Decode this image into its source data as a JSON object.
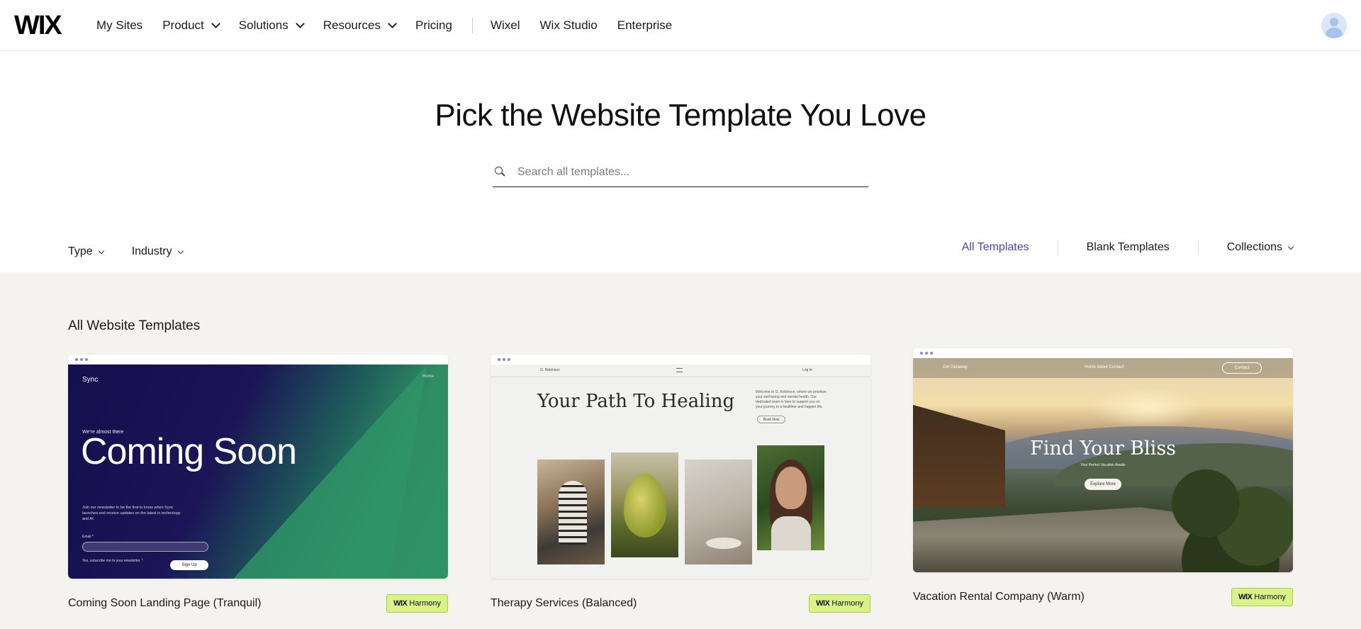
{
  "header": {
    "logo": "WIX",
    "nav": [
      {
        "label": "My Sites",
        "dropdown": false
      },
      {
        "label": "Product",
        "dropdown": true
      },
      {
        "label": "Solutions",
        "dropdown": true
      },
      {
        "label": "Resources",
        "dropdown": true
      },
      {
        "label": "Pricing",
        "dropdown": false
      },
      {
        "label": "Wixel",
        "dropdown": false
      },
      {
        "label": "Wix Studio",
        "dropdown": false
      },
      {
        "label": "Enterprise",
        "dropdown": false
      }
    ],
    "avatar_icon": "user-avatar-icon"
  },
  "hero": {
    "title": "Pick the Website Template You Love",
    "search_placeholder": "Search all templates...",
    "search_icon": "search-icon"
  },
  "filters": {
    "type_label": "Type",
    "industry_label": "Industry",
    "tabs": [
      {
        "label": "All Templates",
        "active": true
      },
      {
        "label": "Blank Templates",
        "active": false
      },
      {
        "label": "Collections",
        "active": false,
        "dropdown": true
      }
    ]
  },
  "gallery": {
    "section_title": "All Website Templates",
    "badge_brand": "WIX",
    "badge_text": "Harmony",
    "cards": [
      {
        "name": "Coming Soon Landing Page (Tranquil)",
        "preview": {
          "brand": "Sync",
          "nav": "Home",
          "pre": "We're almost there",
          "headline": "Coming Soon",
          "desc": "Join our newsletter to be the first to know when Sync launches and receive updates on the latest in technology and AI.",
          "email_label": "Email *",
          "checkbox_label": "Yes, subscribe me to your newsletter. *",
          "button": "Sign Up"
        }
      },
      {
        "name": "Therapy Services (Balanced)",
        "preview": {
          "brand": "G. Robinson",
          "login": "Log In",
          "headline": "Your Path To Healing",
          "text": "Welcome to G. Robinson, where we prioritize your well-being and mental health. Our dedicated team is here to support you on your journey to a healthier and happier life.",
          "button": "Book Now"
        }
      },
      {
        "name": "Vacation Rental Company (Warm)",
        "preview": {
          "brand": "Girl Getaway",
          "links": "Home   About   Contact",
          "contact": "Contact",
          "headline": "Find Your Bliss",
          "sub": "Your Perfect Vacation Awaits",
          "button": "Explore More"
        }
      }
    ]
  },
  "colors": {
    "accent": "#4a3fd6",
    "badge_bg": "#d9f28a",
    "gallery_bg": "#f4f3f0"
  }
}
